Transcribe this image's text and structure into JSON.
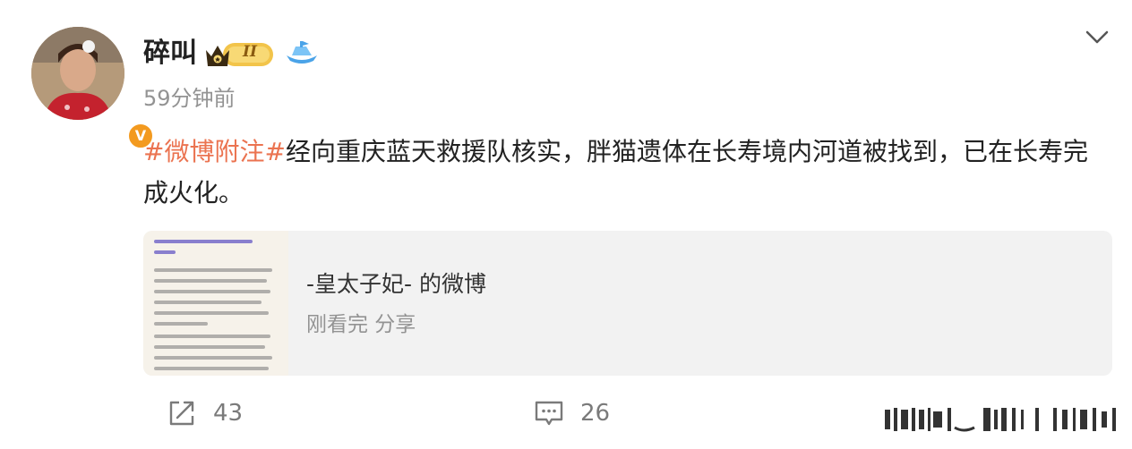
{
  "header": {
    "username": "碎叫",
    "vip_level": "II",
    "timestamp": "59分钟前"
  },
  "post": {
    "hashtag": "#微博附注#",
    "text": "经向重庆蓝天救援队核实，胖猫遗体在长寿境内河道被找到，已在长寿完成火化。"
  },
  "quote_card": {
    "title": "-皇太子妃- 的微博",
    "subtitle": "刚看完 分享"
  },
  "actions": {
    "repost_count": "43",
    "comment_count": "26"
  },
  "icons": {
    "menu": "chevron-down-icon",
    "repost": "repost-icon",
    "comment": "comment-icon",
    "verified": "verified-v-icon",
    "vip": "crown-icon",
    "fan": "fan-boat-icon"
  },
  "colors": {
    "hashtag": "#eb7350",
    "secondary_text": "#939393",
    "card_bg": "#f2f2f2",
    "verified": "#f39a1f"
  }
}
